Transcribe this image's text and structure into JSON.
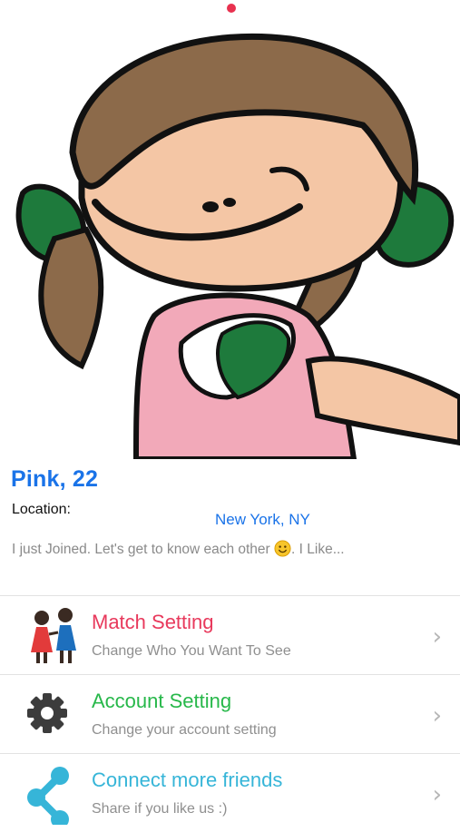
{
  "profile": {
    "name_age": "Pink, 22",
    "location_label": "Location:",
    "location_value": "New York, NY",
    "bio": "I just Joined. Let's get to know each other",
    "bio_suffix": ". I Like...",
    "bio_emoji": "smiling-face-emoji"
  },
  "pager": {
    "indicator_icon": "page-dot-icon",
    "color": "#e8314f"
  },
  "menu": {
    "items": [
      {
        "title": "Match Setting",
        "subtitle": "Change Who You Want To See",
        "color": "#e8395c",
        "icon": "couple-icon"
      },
      {
        "title": "Account Setting",
        "subtitle": "Change your account setting",
        "color": "#27b84a",
        "icon": "gear-icon"
      },
      {
        "title": "Connect more friends",
        "subtitle": "Share if you like us :)",
        "color": "#36b5d8",
        "icon": "share-icon"
      }
    ],
    "chevron_icon": "chevron-right-icon"
  },
  "colors": {
    "accent_blue": "#1a73e8"
  }
}
